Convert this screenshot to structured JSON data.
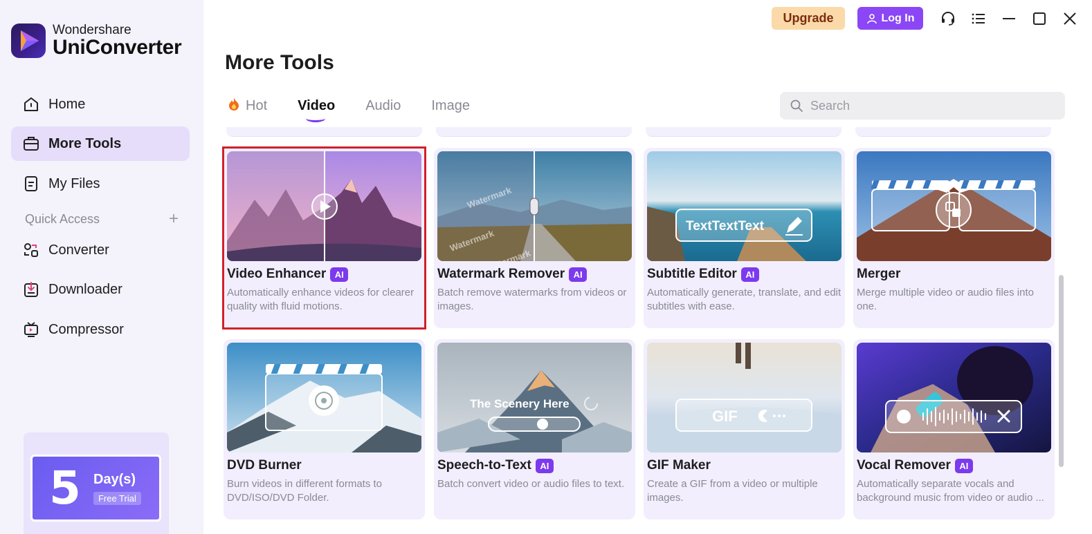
{
  "brand": {
    "small": "Wondershare",
    "big": "UniConverter"
  },
  "nav": [
    {
      "label": "Home",
      "icon": "home-icon",
      "active": false
    },
    {
      "label": "More Tools",
      "icon": "toolbox-icon",
      "active": true
    },
    {
      "label": "My Files",
      "icon": "files-icon",
      "active": false
    }
  ],
  "quick_access": {
    "label": "Quick Access",
    "add": "+"
  },
  "quick_items": [
    {
      "label": "Converter",
      "icon": "converter-icon"
    },
    {
      "label": "Downloader",
      "icon": "downloader-icon"
    },
    {
      "label": "Compressor",
      "icon": "compressor-icon"
    }
  ],
  "trial": {
    "number": "5",
    "days": "Day(s)",
    "badge": "Free Trial"
  },
  "topbar": {
    "upgrade": "Upgrade",
    "login": "Log In"
  },
  "page_title": "More Tools",
  "tabs": [
    {
      "label": "Hot",
      "icon": "fire-icon",
      "active": false
    },
    {
      "label": "Video",
      "active": true
    },
    {
      "label": "Audio",
      "active": false
    },
    {
      "label": "Image",
      "active": false
    }
  ],
  "search": {
    "placeholder": "Search",
    "value": ""
  },
  "cards": [
    {
      "title": "Video Enhancer",
      "ai": "AI",
      "desc": "Automatically enhance videos for clearer quality with fluid motions."
    },
    {
      "title": "Watermark Remover",
      "ai": "AI",
      "desc": "Batch remove watermarks from videos or images."
    },
    {
      "title": "Subtitle Editor",
      "ai": "AI",
      "desc": "Automatically generate, translate, and edit subtitles with ease."
    },
    {
      "title": "Merger",
      "ai": "",
      "desc": "Merge multiple video or audio files into one."
    },
    {
      "title": "DVD Burner",
      "ai": "",
      "desc": "Burn videos in different formats to DVD/ISO/DVD Folder."
    },
    {
      "title": "Speech-to-Text",
      "ai": "AI",
      "desc": "Batch convert video or audio files to text."
    },
    {
      "title": "GIF Maker",
      "ai": "",
      "desc": "Create a GIF from a video or multiple images."
    },
    {
      "title": "Vocal Remover",
      "ai": "AI",
      "desc": "Automatically separate vocals and background music from video or audio ..."
    }
  ],
  "thumb_text": {
    "watermark": "Watermark",
    "subtitle": "TextTextText",
    "scenery": "The Scenery Here",
    "gif": "GIF"
  },
  "colors": {
    "accent": "#7c3aed",
    "selected_outline": "#d0202a",
    "upgrade_bg": "#fbd9a8",
    "login_bg": "#8b47f5"
  }
}
